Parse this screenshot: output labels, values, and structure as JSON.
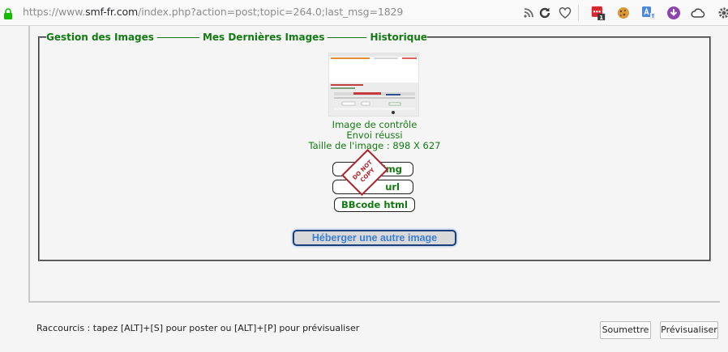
{
  "browser": {
    "url_prefix": "https://www.",
    "url_host": "smf-fr.com",
    "url_path": "/index.php?action=post;topic=264.0;last_msg=1829",
    "extension_badge": "1"
  },
  "panel": {
    "legend_tabs": [
      "Gestion des Images",
      "Mes Dernières Images",
      "Historique"
    ]
  },
  "upload": {
    "caption": "Image de contrôle",
    "status": "Envoi réussi",
    "size_text": "Taille de l'image : 898 X 627",
    "code_buttons": [
      "img",
      "url",
      "BBcode html"
    ],
    "watermark": "DO NOT COPY",
    "host_another_label": "Héberger une autre image"
  },
  "footer": {
    "shortcuts_text": "Raccourcis : tapez [ALT]+[S] pour poster ou [ALT]+[P] pour prévisualiser",
    "submit_label": "Soumettre",
    "preview_label": "Prévisualiser"
  },
  "colors": {
    "green_text": "#137a13",
    "accent_blue": "#3b7fd6",
    "stamp_red": "#b0222a"
  }
}
